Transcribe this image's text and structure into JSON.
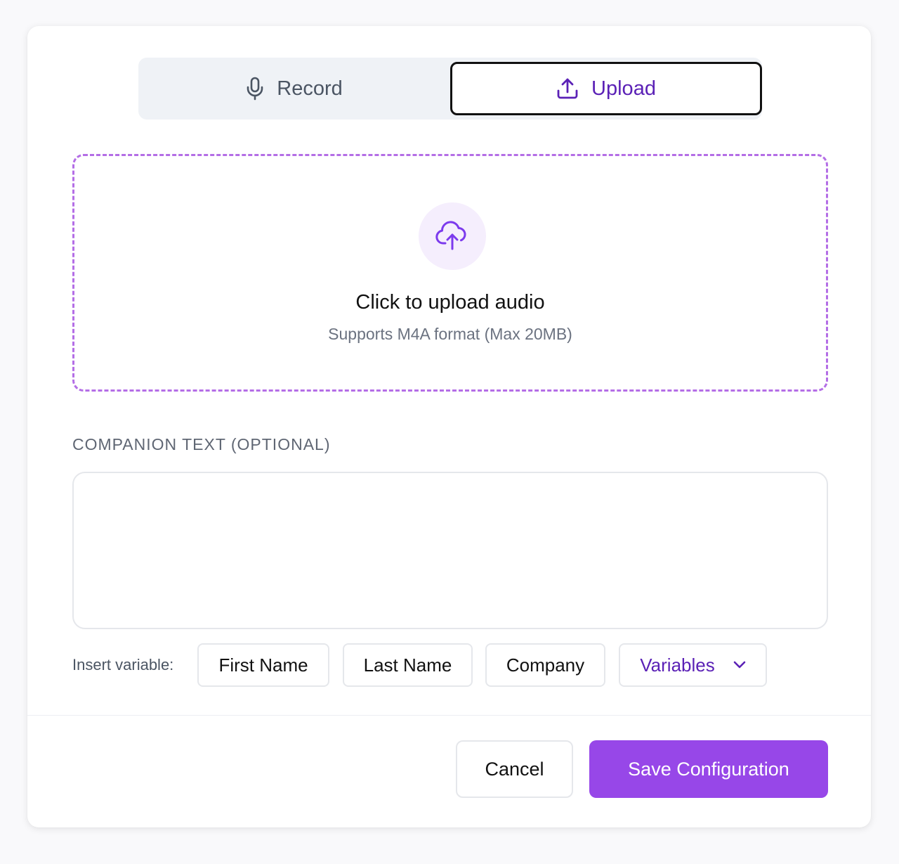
{
  "tabs": {
    "record_label": "Record",
    "upload_label": "Upload",
    "active": "upload"
  },
  "dropzone": {
    "title": "Click to upload audio",
    "subtitle": "Supports M4A format (Max 20MB)",
    "icon": "cloud-upload-icon"
  },
  "companion": {
    "label": "COMPANION TEXT (OPTIONAL)",
    "value": "",
    "placeholder": ""
  },
  "variables": {
    "label": "Insert variable:",
    "buttons": [
      "First Name",
      "Last Name",
      "Company"
    ],
    "dropdown_label": "Variables"
  },
  "footer": {
    "cancel_label": "Cancel",
    "save_label": "Save Configuration"
  },
  "colors": {
    "accent": "#9747e8",
    "accent_text": "#5b21b6",
    "dropzone_border": "#b46ee6"
  }
}
